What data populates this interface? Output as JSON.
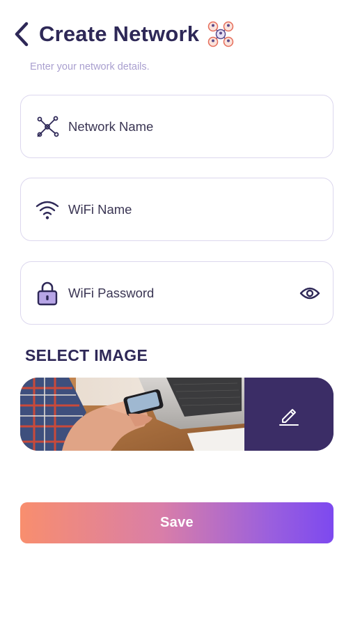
{
  "header": {
    "title": "Create Network",
    "subtitle": "Enter your network details."
  },
  "form": {
    "network_name": {
      "placeholder": "Network Name",
      "icon": "network-nodes-icon"
    },
    "wifi_name": {
      "placeholder": "WiFi Name",
      "icon": "wifi-icon"
    },
    "wifi_password": {
      "placeholder": "WiFi Password",
      "icon": "lock-icon",
      "toggle_icon": "eye-icon"
    }
  },
  "image_section": {
    "title": "SELECT IMAGE",
    "edit_icon": "pencil-icon"
  },
  "save_label": "Save",
  "colors": {
    "primary": "#2e2857",
    "accent_purple": "#3b2d66",
    "field_border": "#dcd7ee",
    "subtitle": "#a99fcf",
    "gradient_start": "#f88e6e",
    "gradient_end": "#7d49ef"
  }
}
